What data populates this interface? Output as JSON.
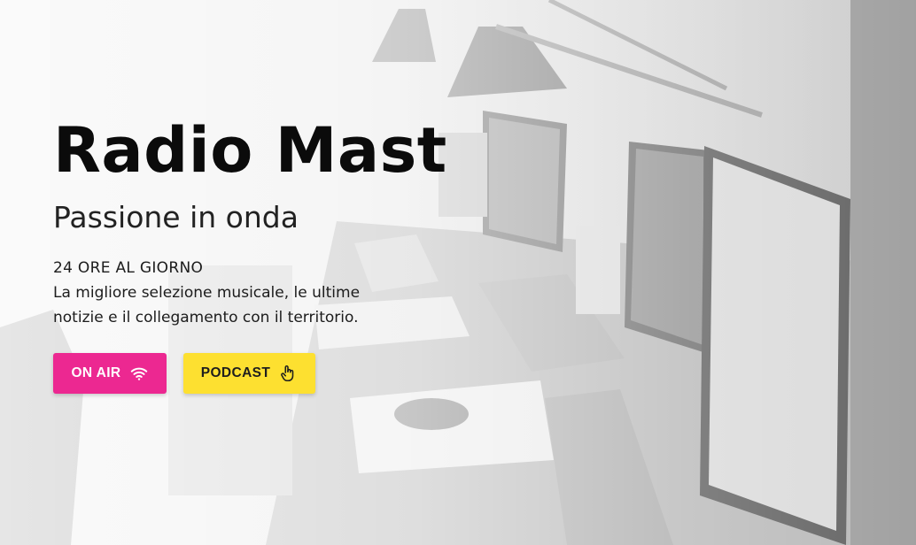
{
  "hero": {
    "title": "Radio Mast",
    "subtitle": "Passione in onda",
    "hours": "24 ORE AL GIORNO",
    "description": "La migliore selezione musicale, le ultime notizie e il collegamento con il territorio."
  },
  "buttons": {
    "on_air": {
      "label": "ON AIR",
      "icon": "wifi-icon",
      "color": "#ec2891"
    },
    "podcast": {
      "label": "PODCAST",
      "icon": "hand-pointer-icon",
      "color": "#fde030"
    }
  }
}
